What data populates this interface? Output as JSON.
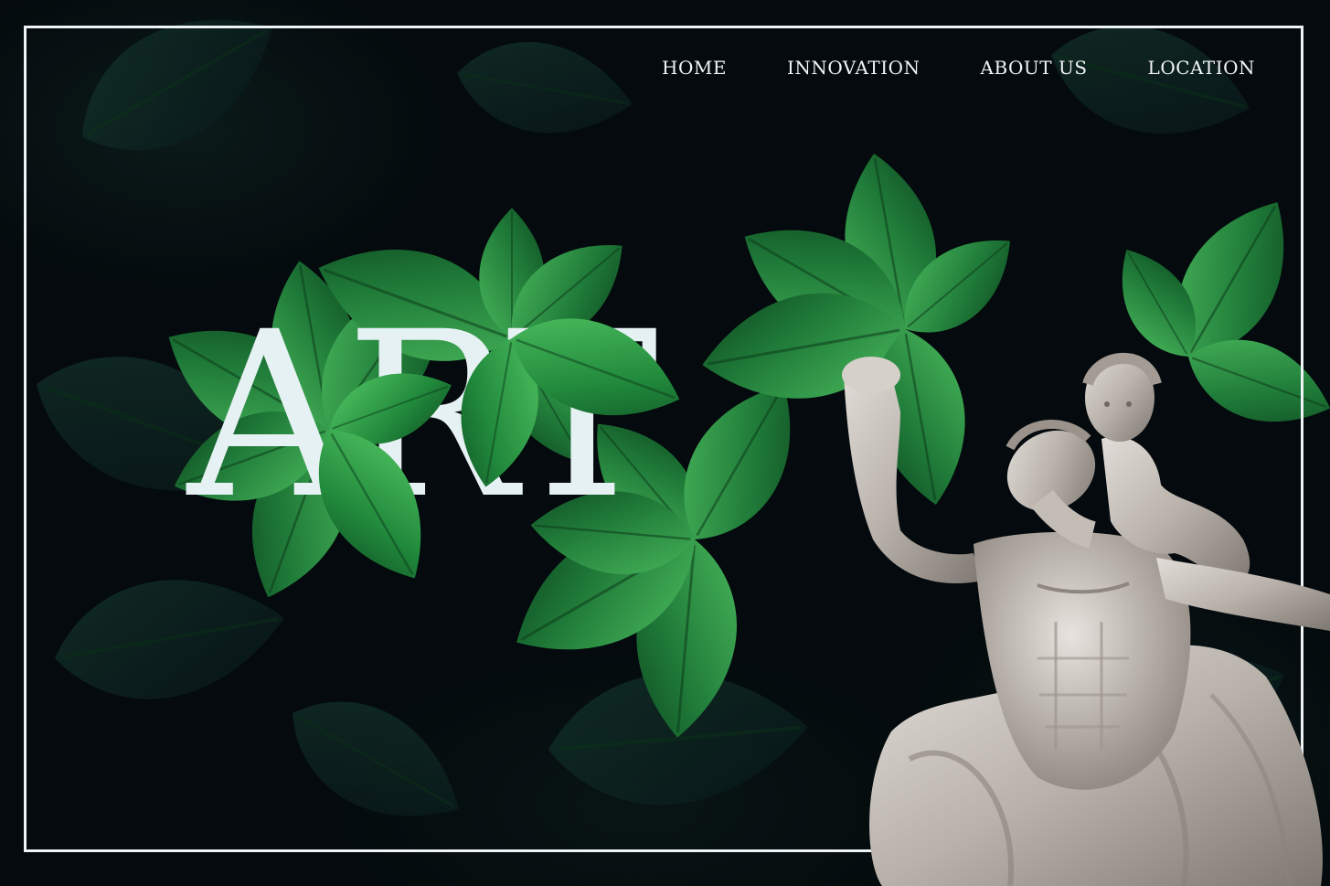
{
  "nav": {
    "items": [
      {
        "label": "HOME"
      },
      {
        "label": "INNOVATION"
      },
      {
        "label": "ABOUT US"
      },
      {
        "label": "LOCATION"
      }
    ]
  },
  "hero": {
    "title": "ART"
  },
  "colors": {
    "background": "#040a0d",
    "leaf_green": "#1f7a38",
    "leaf_light": "#3fae54",
    "frame": "#eef3f6",
    "title": "#e6f1f4",
    "marble": "#c9c4bf"
  },
  "images": {
    "background": "dark foliage with bright green leaves",
    "statue": "marble statue"
  }
}
